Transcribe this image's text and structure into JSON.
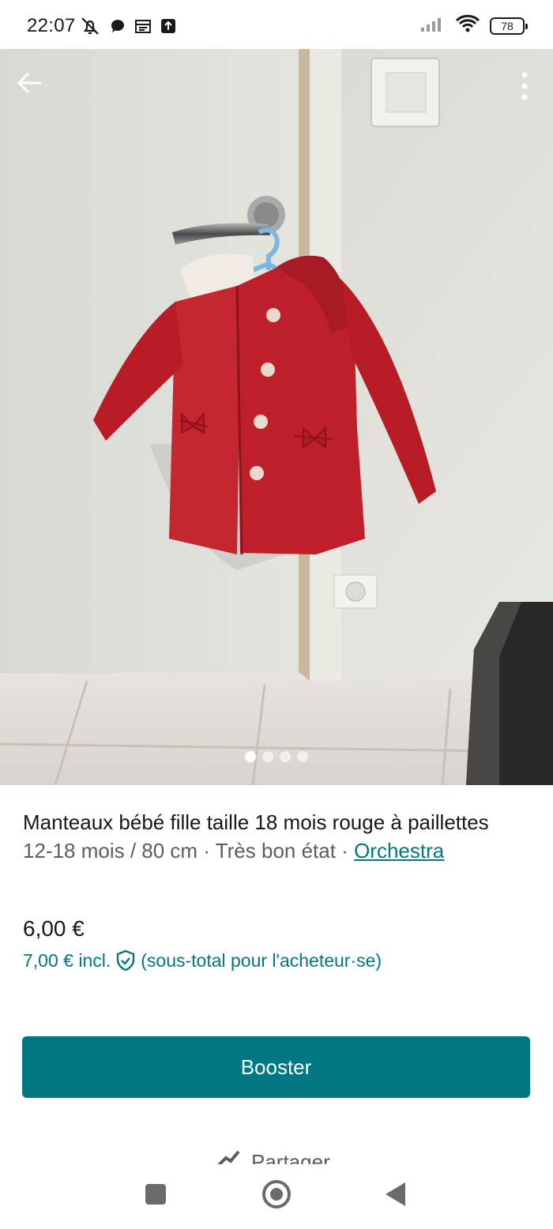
{
  "status_bar": {
    "time": "22:07",
    "battery": "78",
    "left_icons": [
      "mute-icon",
      "chat-icon",
      "calendar-icon",
      "upload-icon"
    ],
    "right_icons": [
      "signal-icon",
      "wifi-icon",
      "battery-icon"
    ]
  },
  "gallery": {
    "image_count": 4,
    "active_index": 0,
    "back_icon": "arrow-left-icon",
    "menu_icon": "more-vertical-icon"
  },
  "item": {
    "title": "Manteaux bébé fille taille 18 mois rouge à paillettes",
    "size": "12-18 mois / 80 cm",
    "separator": " · ",
    "condition": "Très bon état",
    "brand": "Orchestra",
    "price": "6,00 €",
    "price_incl": "7,00 € incl.",
    "price_incl_note": "(sous-total pour l'acheteur·se)"
  },
  "actions": {
    "booster_label": "Booster",
    "share_label": "Partager"
  },
  "colors": {
    "accent": "#007782",
    "coat": "#c0202a"
  }
}
